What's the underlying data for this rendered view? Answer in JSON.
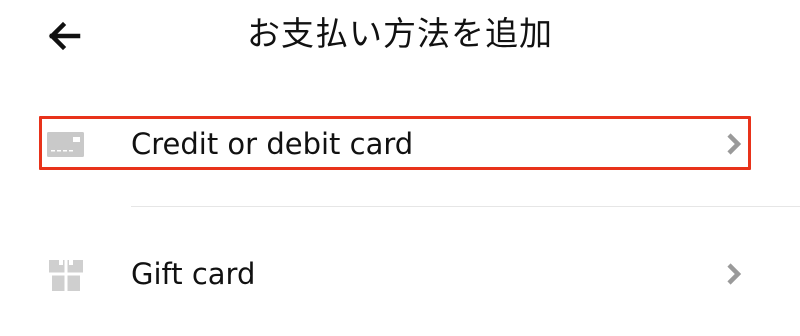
{
  "header": {
    "back_icon": "arrow-left-icon",
    "title": "お支払い方法を追加"
  },
  "payment_options": [
    {
      "label": "Credit or debit card",
      "icon": "credit-card-icon",
      "highlighted": true
    },
    {
      "label": "Gift card",
      "icon": "gift-icon",
      "highlighted": false
    }
  ],
  "colors": {
    "highlight": "#e8321a",
    "icon_gray": "#c4c4c4",
    "chevron_gray": "#999999",
    "text": "#111111"
  }
}
